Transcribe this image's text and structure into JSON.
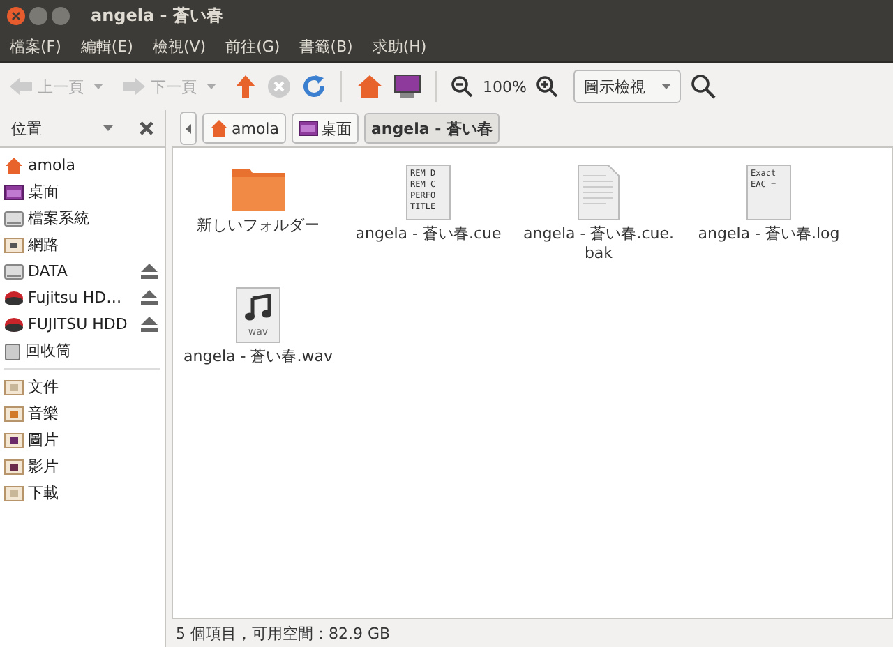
{
  "window": {
    "title": "angela - 蒼い春"
  },
  "menu": [
    "檔案(F)",
    "編輯(E)",
    "檢視(V)",
    "前往(G)",
    "書籤(B)",
    "求助(H)"
  ],
  "toolbar": {
    "back": {
      "label": "上一頁",
      "disabled": true
    },
    "forward": {
      "label": "下一頁",
      "disabled": true
    },
    "stop_disabled": true,
    "zoom": "100%",
    "view": "圖示檢視"
  },
  "sidebar": {
    "title": "位置",
    "groups": [
      [
        {
          "label": "amola",
          "kind": "home",
          "ejectable": false
        },
        {
          "label": "桌面",
          "kind": "desktop",
          "ejectable": false
        },
        {
          "label": "檔案系統",
          "kind": "drive",
          "ejectable": false
        },
        {
          "label": "網路",
          "kind": "network",
          "ejectable": false
        },
        {
          "label": "DATA",
          "kind": "drive",
          "ejectable": true
        },
        {
          "label": "Fujitsu HD…",
          "kind": "hdd",
          "ejectable": true
        },
        {
          "label": "FUJITSU HDD",
          "kind": "hdd",
          "ejectable": true
        },
        {
          "label": "回收筒",
          "kind": "trash",
          "ejectable": false
        }
      ],
      [
        {
          "label": "文件",
          "kind": "documents",
          "ejectable": false
        },
        {
          "label": "音樂",
          "kind": "music",
          "ejectable": false
        },
        {
          "label": "圖片",
          "kind": "pictures",
          "ejectable": false
        },
        {
          "label": "影片",
          "kind": "videos",
          "ejectable": false
        },
        {
          "label": "下載",
          "kind": "downloads",
          "ejectable": false
        }
      ]
    ]
  },
  "breadcrumbs": [
    {
      "label": "amola",
      "kind": "home",
      "selected": false
    },
    {
      "label": "桌面",
      "kind": "desktop",
      "selected": false
    },
    {
      "label": "angela - 蒼い春",
      "kind": "none",
      "selected": true
    }
  ],
  "files": [
    {
      "name": "新しいフォルダー",
      "kind": "folder"
    },
    {
      "name": "angela - 蒼い春.cue",
      "kind": "preview",
      "preview": [
        "REM D",
        "REM C",
        "PERFO",
        "TITLE"
      ]
    },
    {
      "name": "angela - 蒼い春.cue.\nbak",
      "kind": "text"
    },
    {
      "name": "angela - 蒼い春.log",
      "kind": "preview",
      "preview": [
        "Exact",
        "EAC ="
      ]
    },
    {
      "name": "angela - 蒼い春.wav",
      "kind": "audio",
      "badge": "wav"
    }
  ],
  "status_bar": "5 個項目，可用空間：82.9 GB"
}
